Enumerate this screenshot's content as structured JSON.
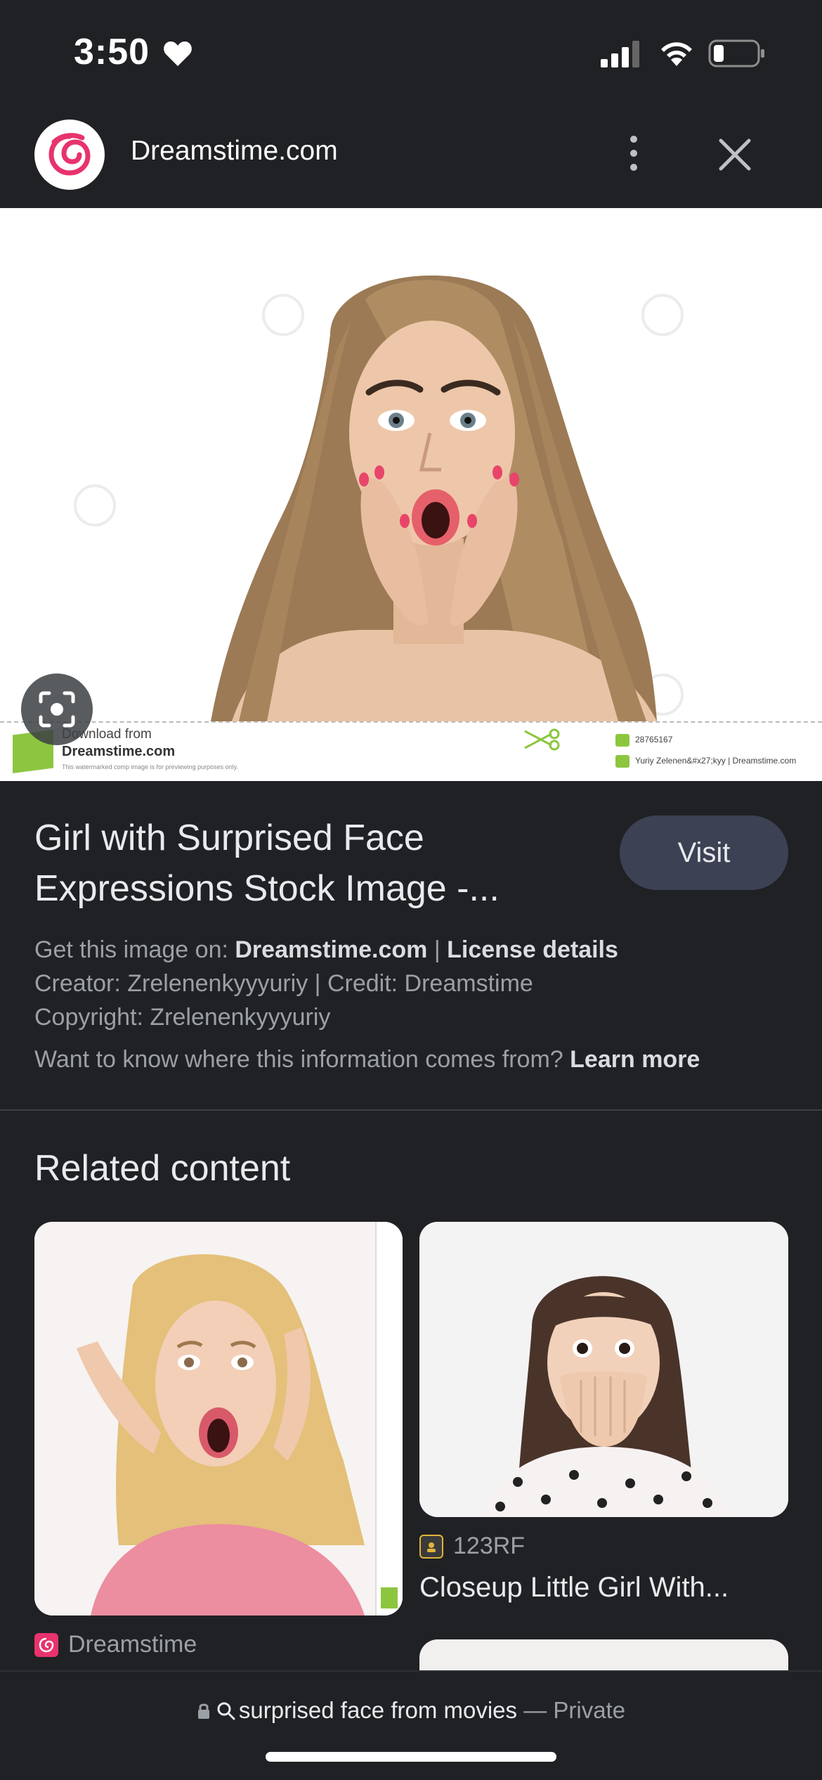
{
  "status_bar": {
    "time": "3:50",
    "icons": [
      "heart-icon",
      "signal-icon",
      "wifi-icon",
      "battery-icon"
    ]
  },
  "header": {
    "site_name": "Dreamstime.com",
    "logo_icon": "dreamstime-logo-icon",
    "menu_icon": "more-vert-icon",
    "close_icon": "close-icon"
  },
  "main_image": {
    "description_icon": "photo-of-surprised-woman",
    "watermark": {
      "download_from": "Download from",
      "site": "Dreamstime.com",
      "notice": "This watermarked comp image is for previewing purposes only.",
      "id": "28765167",
      "credit": "Yuriy Zelenen&#x27;kyy | Dreamstime.com"
    },
    "lens_icon": "lens-search-icon"
  },
  "info": {
    "title": "Girl with Surprised Face Expressions Stock Image -...",
    "visit_label": "Visit",
    "get_image_prefix": "Get this image on: ",
    "get_image_site": "Dreamstime.com",
    "separator": " | ",
    "license_link": "License details",
    "creator_line": "Creator: Zrelenenkyyyuriy | Credit: Dreamstime",
    "copyright_line": "Copyright: Zrelenenkyyyuriy",
    "learn_prefix": "Want to know where this information comes from? ",
    "learn_link": "Learn more"
  },
  "related": {
    "heading": "Related content",
    "items": [
      {
        "source": "Dreamstime",
        "source_icon": "dreamstime-logo-icon",
        "caption": ""
      },
      {
        "source": "123RF",
        "source_icon": "123rf-logo-icon",
        "caption": "Closeup Little Girl With..."
      }
    ]
  },
  "bottom_bar": {
    "query": "surprised face from movies",
    "dash": " — ",
    "mode": "Private",
    "icons": [
      "lock-icon",
      "search-icon"
    ]
  },
  "colors": {
    "background": "#202124",
    "visit_button": "#3c4254",
    "brand_pink": "#e8336d",
    "brand_green": "#8cc63f"
  }
}
